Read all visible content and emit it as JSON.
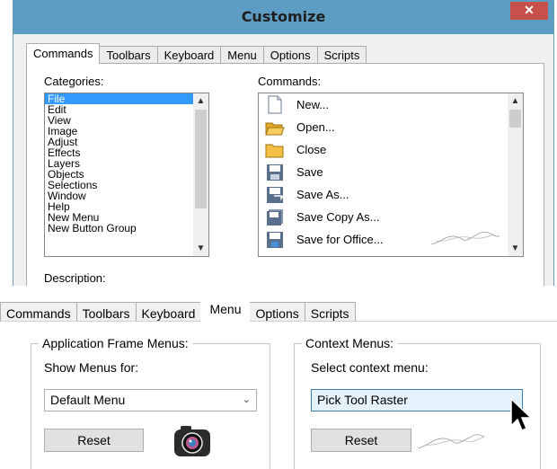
{
  "dialog": {
    "title": "Customize",
    "close_label": "✕",
    "tabs": [
      "Commands",
      "Toolbars",
      "Keyboard",
      "Menu",
      "Options",
      "Scripts"
    ],
    "active_tab": "Commands"
  },
  "categories": {
    "label": "Categories:",
    "items": [
      "File",
      "Edit",
      "View",
      "Image",
      "Adjust",
      "Effects",
      "Layers",
      "Objects",
      "Selections",
      "Window",
      "Help",
      "New Menu",
      "New Button Group"
    ],
    "selected": "File"
  },
  "commands": {
    "label": "Commands:",
    "items": [
      {
        "label": "New...",
        "icon": "new-document-icon"
      },
      {
        "label": "Open...",
        "icon": "open-folder-icon"
      },
      {
        "label": "Close",
        "icon": "close-folder-icon"
      },
      {
        "label": "Save",
        "icon": "save-icon"
      },
      {
        "label": "Save As...",
        "icon": "save-as-icon"
      },
      {
        "label": "Save Copy As...",
        "icon": "save-copy-icon"
      },
      {
        "label": "Save for Office...",
        "icon": "save-office-icon"
      }
    ]
  },
  "description_label": "Description:",
  "lower_panel": {
    "tabs": [
      "Commands",
      "Toolbars",
      "Keyboard",
      "Menu",
      "Options",
      "Scripts"
    ],
    "active_tab": "Menu",
    "app_frame": {
      "title": "Application Frame Menus:",
      "show_label": "Show Menus for:",
      "selected_menu": "Default Menu",
      "reset_label": "Reset"
    },
    "context": {
      "title": "Context Menus:",
      "select_label": "Select context menu:",
      "selected_menu": "Pick Tool Raster",
      "reset_label": "Reset"
    }
  },
  "colors": {
    "titlebar": "#5d9dc4",
    "close": "#c7504b",
    "selection": "#3399ff"
  }
}
